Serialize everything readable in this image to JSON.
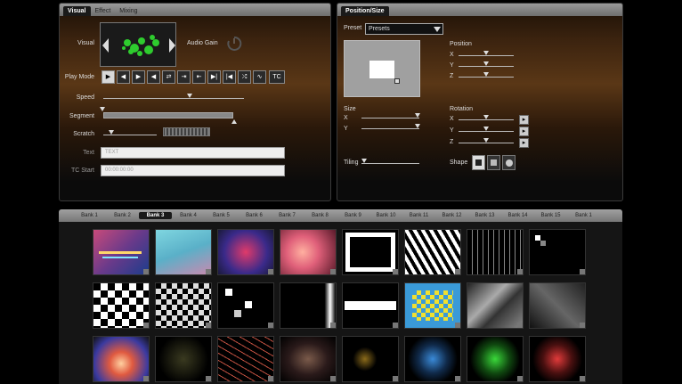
{
  "visual_panel": {
    "tabs": [
      "Visual",
      "Effect",
      "Mixing"
    ],
    "visual_label": "Visual",
    "audio_gain_label": "Audio Gain",
    "play_mode_label": "Play Mode",
    "play_mode_last": "TC",
    "speed_label": "Speed",
    "speed_value": 0.52,
    "segment_label": "Segment",
    "scratch_label": "Scratch",
    "text_label": "Text",
    "text_placeholder": "TEXT",
    "tc_start_label": "TC Start",
    "tc_start_placeholder": "00:00:00:00"
  },
  "position_panel": {
    "tab": "Position/Size",
    "preset_label": "Preset",
    "preset_value": "Presets",
    "position_label": "Position",
    "size_label": "Size",
    "rotation_label": "Rotation",
    "tiling_label": "Tiling",
    "shape_label": "Shape",
    "axis_x": "X",
    "axis_y": "Y",
    "axis_z": "Z"
  },
  "banks": {
    "items": [
      "Bank 1",
      "Bank 2",
      "Bank 3",
      "Bank 4",
      "Bank 5",
      "Bank 6",
      "Bank 7",
      "Bank 8",
      "Bank 9",
      "Bank 10",
      "Bank 11",
      "Bank 12",
      "Bank 13",
      "Bank 14",
      "Bank 15",
      "Bank 1"
    ],
    "active_index": 2
  },
  "colors": {
    "accent": "#5a3716",
    "panel_dark": "#0b0b0b",
    "selection": "#d8d8d8"
  }
}
